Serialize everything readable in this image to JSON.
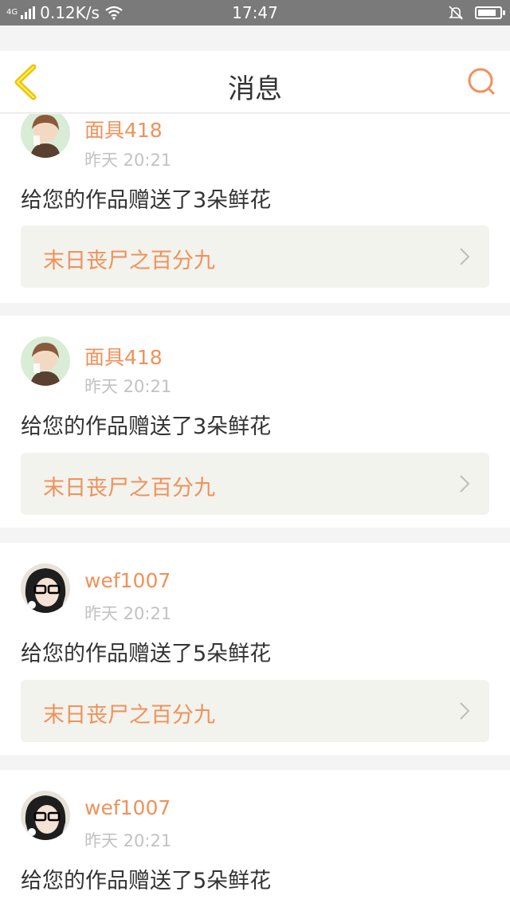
{
  "status_bar": {
    "network_type": "4G",
    "speed": "0.12K/s",
    "time": "17:47",
    "battery_level": 0.85
  },
  "nav": {
    "title": "消息"
  },
  "colors": {
    "accent": "#f0915a",
    "back_arrow": "#f2c200",
    "link_bg": "#f3f3ed"
  },
  "messages": [
    {
      "username": "面具418",
      "time": "昨天 20:21",
      "text": "给您的作品赠送了3朵鲜花",
      "work_title": "末日丧尸之百分九"
    },
    {
      "username": "面具418",
      "time": "昨天 20:21",
      "text": "给您的作品赠送了3朵鲜花",
      "work_title": "末日丧尸之百分九"
    },
    {
      "username": "wef1007",
      "time": "昨天 20:21",
      "text": "给您的作品赠送了5朵鲜花",
      "work_title": "末日丧尸之百分九"
    },
    {
      "username": "wef1007",
      "time": "昨天 20:21",
      "text": "给您的作品赠送了5朵鲜花"
    }
  ]
}
